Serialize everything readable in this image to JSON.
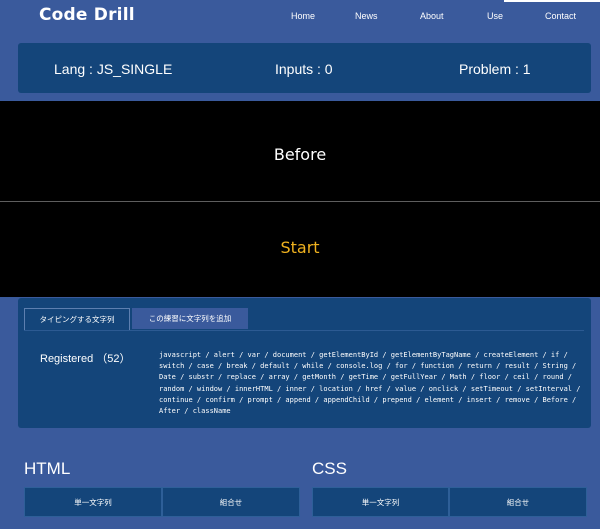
{
  "app": {
    "title": "Code Drill"
  },
  "nav": {
    "items": [
      "Home",
      "News",
      "About",
      "Use",
      "Contact"
    ]
  },
  "stats": {
    "lang": "Lang : JS_SINGLE",
    "inputs": "Inputs : 0",
    "problem": "Problem : 1"
  },
  "stage": {
    "prompt": "Before",
    "action": "Start"
  },
  "panel": {
    "tabs": [
      "タイピングする文字列",
      "この練習に文字列を追加"
    ],
    "registered_label": "Registered （52）",
    "words": "javascript / alert / var / document / getElementById / getElementByTagName / createElement / if / switch / case / break / default / while / console.log / for / function / return / result / String / Date / substr / replace / array / getMonth / getTime / getFullYear / Math / floor / ceil / round / random / window / innerHTML / inner / location / href / value / onclick / setTimeout / setInterval / continue / confirm / prompt / append / appendChild / prepend / element / insert / remove / Before / After / className"
  },
  "sections": {
    "html": {
      "title": "HTML",
      "buttons": [
        "単一文字列",
        "組合せ"
      ]
    },
    "css": {
      "title": "CSS",
      "buttons": [
        "単一文字列",
        "組合せ"
      ]
    }
  },
  "colors": {
    "background": "#3a5a9c",
    "panel": "#14457a",
    "stage": "#000000",
    "start": "#f0b21f"
  }
}
